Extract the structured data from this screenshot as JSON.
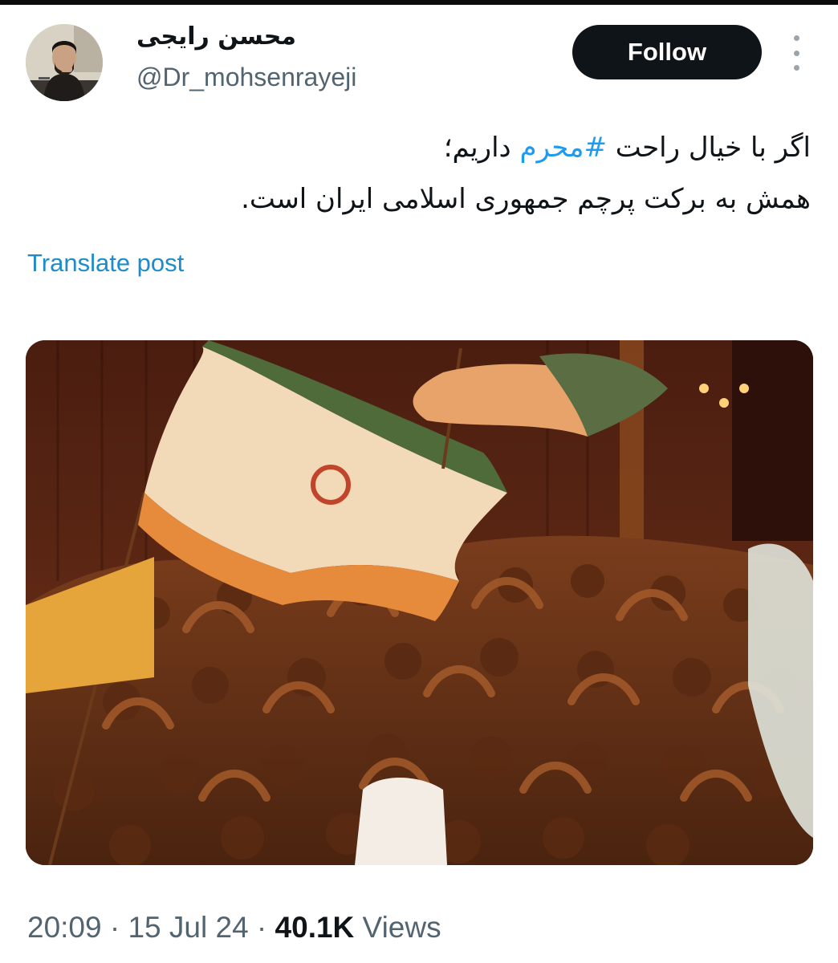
{
  "author": {
    "display_name": "محسن رایجی",
    "handle": "@Dr_mohsenrayeji"
  },
  "actions": {
    "follow_label": "Follow",
    "more_icon": "more-vertical-icon"
  },
  "post": {
    "line1_before": "اگر با خیال راحت ",
    "hashtag": "#محرم",
    "line1_after": " داریم؛",
    "line2": "همش به برکت پرچم جمهوری اسلامی ایران است.",
    "translate_label": "Translate post"
  },
  "meta": {
    "time": "20:09",
    "sep1": " · ",
    "date": "15 Jul 24",
    "sep2": " · ",
    "views_count": "40.1K",
    "views_label": " Views"
  },
  "colors": {
    "link": "#1d9bf0",
    "text": "#0f1419",
    "muted": "#536471",
    "button_bg": "#0f1419"
  }
}
